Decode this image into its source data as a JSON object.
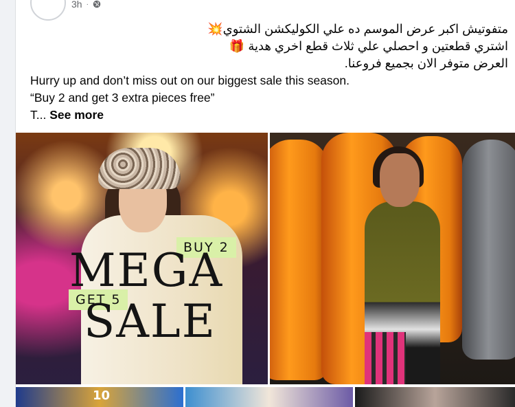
{
  "post": {
    "time": "3h",
    "dot": "·",
    "audience_icon": "globe-icon",
    "arabic_lines": [
      "متفوتيش اكبر عرض الموسم ده علي الكوليكشن الشتوي💥",
      "اشتري قطعتين و احصلي علي ثلاث قطع اخري هدية 🎁",
      "العرض متوفر الان بجميع فروعنا."
    ],
    "english_lines": [
      "Hurry up and don’t miss out on our biggest sale this season.",
      "“Buy 2 and get 3 extra pieces free”"
    ],
    "truncated_prefix": "T... ",
    "see_more": "See more"
  },
  "photos": {
    "main": {
      "badge_top": "BUY 2",
      "headline_1": "MEGA",
      "badge_bottom": "GET 5",
      "headline_2": "SALE"
    },
    "thumb_text": "10"
  },
  "colors": {
    "card_bg": "#ffffff",
    "meta_text": "#65676b",
    "badge_bg": "#d9f0a8"
  }
}
